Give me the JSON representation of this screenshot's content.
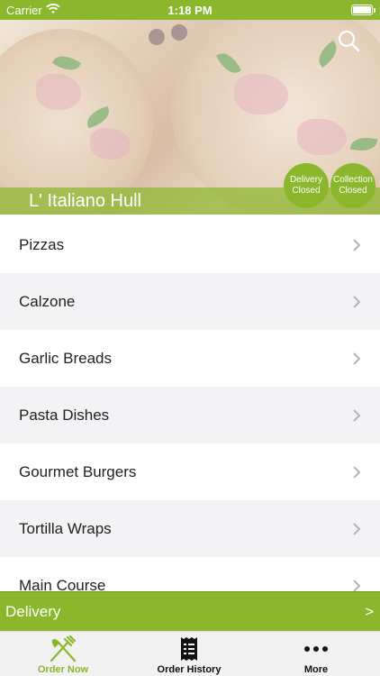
{
  "status_bar": {
    "carrier": "Carrier",
    "time": "1:18 PM"
  },
  "header": {
    "restaurant_name": "L' Italiano Hull",
    "search_icon": "search-icon",
    "delivery_status": {
      "line1": "Delivery",
      "line2": "Closed"
    },
    "collection_status": {
      "line1": "Collection",
      "line2": "Closed"
    }
  },
  "menu": {
    "items": [
      {
        "label": "Pizzas"
      },
      {
        "label": "Calzone"
      },
      {
        "label": "Garlic Breads"
      },
      {
        "label": "Pasta Dishes"
      },
      {
        "label": "Gourmet Burgers"
      },
      {
        "label": "Tortilla Wraps"
      },
      {
        "label": "Main Course"
      }
    ]
  },
  "delivery_bar": {
    "label": "Delivery",
    "arrow": ">"
  },
  "tabs": [
    {
      "label": "Order Now",
      "icon": "fork-knife-icon",
      "active": true
    },
    {
      "label": "Order History",
      "icon": "receipt-icon",
      "active": false
    },
    {
      "label": "More",
      "icon": "more-icon",
      "active": false
    }
  ],
  "colors": {
    "accent": "#8ab72c",
    "row_alt": "#f3f3f5",
    "text": "#222222"
  }
}
